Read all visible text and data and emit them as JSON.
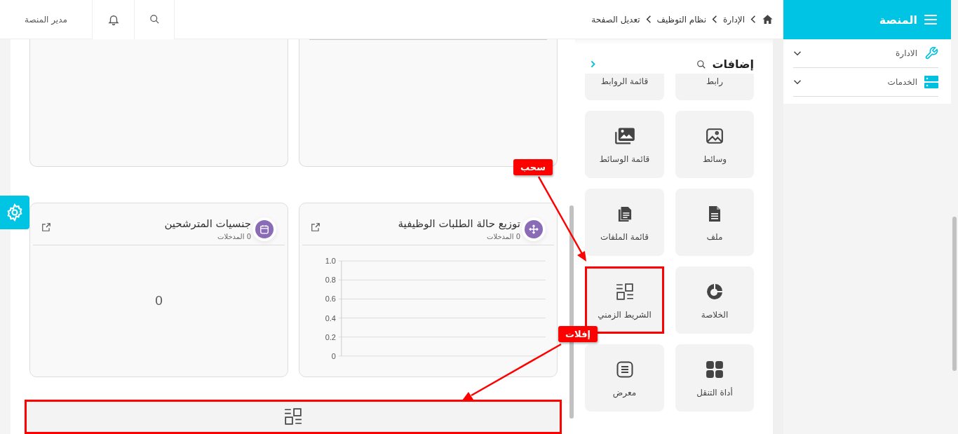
{
  "sidebar": {
    "title": "المنصة",
    "items": [
      {
        "label": "الادارة",
        "expanded": false
      },
      {
        "label": "الخدمات",
        "expanded": false
      }
    ]
  },
  "topbar": {
    "breadcrumbs": [
      "الإدارة",
      "نظام التوظيف",
      "تعديل الصفحة"
    ],
    "user": "مدير المنصة"
  },
  "additions": {
    "title": "إضافات",
    "items": [
      {
        "label": "رابط",
        "highlighted": false
      },
      {
        "label": "قائمة الروابط",
        "highlighted": false
      },
      {
        "label": "وسائط",
        "highlighted": false
      },
      {
        "label": "قائمة الوسائط",
        "highlighted": false
      },
      {
        "label": "ملف",
        "highlighted": false
      },
      {
        "label": "قائمة الملفات",
        "highlighted": false
      },
      {
        "label": "الخلاصة",
        "highlighted": false
      },
      {
        "label": "الشريط الزمني",
        "highlighted": true
      },
      {
        "label": "أداة التنقل",
        "highlighted": false
      },
      {
        "label": "معرض",
        "highlighted": false
      }
    ]
  },
  "widgets": [
    {
      "title": "توزيع حالة الطلبات الوظيفية",
      "count": "0 المدخلات",
      "kind": "chart",
      "chart_data": {
        "type": "bar",
        "grid": true,
        "categories": [
          null
        ],
        "values": [
          null
        ],
        "ylim": [
          0,
          1
        ],
        "yticks": [
          0,
          0.2,
          0.4,
          0.6,
          0.8,
          {
            "value": 1,
            "label": "1.0"
          }
        ]
      }
    },
    {
      "title": "جنسيات المترشحين",
      "count": "0 المدخلات",
      "kind": "value",
      "value": "0"
    }
  ],
  "annotations": [
    {
      "text": "سحب"
    },
    {
      "text": "إفلات"
    }
  ]
}
